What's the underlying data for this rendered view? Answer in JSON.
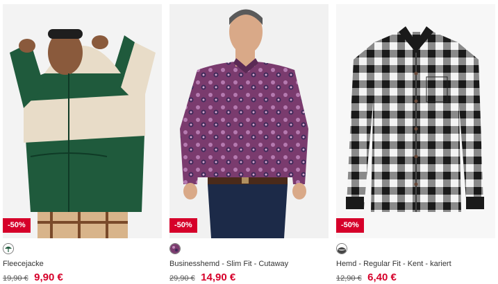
{
  "products": [
    {
      "name": "Fleecejacke",
      "old_price": "19,90 €",
      "new_price": "9,90 €",
      "badge": "-50%",
      "swatch_color": "#1f5a3c",
      "image": "man-in-green-beige-fleece-hoodie"
    },
    {
      "name": "Businesshemd - Slim Fit - Cutaway",
      "old_price": "29,90 €",
      "new_price": "14,90 €",
      "badge": "-50%",
      "swatch_color": "#7a3b6e",
      "image": "man-in-purple-paisley-shirt"
    },
    {
      "name": "Hemd - Regular Fit - Kent - kariert",
      "old_price": "12,90 €",
      "new_price": "6,40 €",
      "badge": "-50%",
      "swatch_color": "#444444",
      "image": "black-white-checked-shirt"
    }
  ],
  "colors": {
    "sale_red": "#d6002a",
    "text": "#333333"
  }
}
